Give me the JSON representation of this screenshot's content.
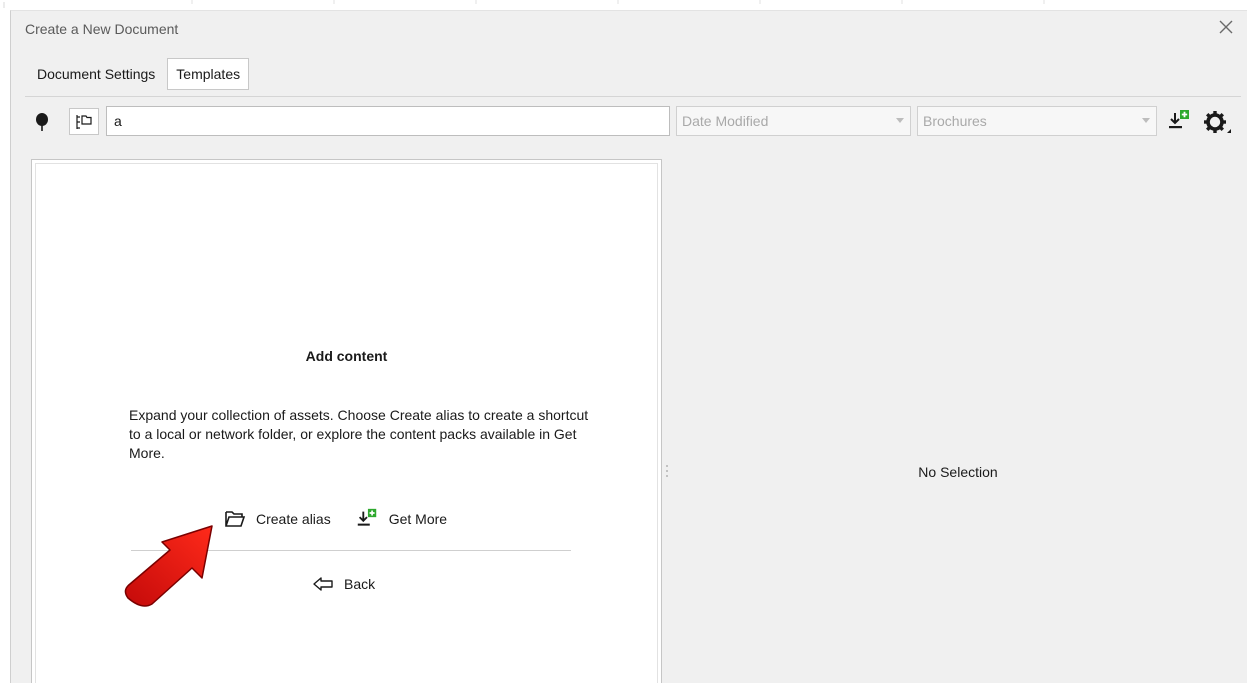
{
  "window": {
    "title": "Create a New Document",
    "close_label": "×"
  },
  "tabs": [
    {
      "label": "Document Settings",
      "active": false
    },
    {
      "label": "Templates",
      "active": true
    }
  ],
  "toolbar": {
    "pin_icon": "pin-icon",
    "tree_icon": "folder-tree-icon",
    "search_value": "a",
    "sort_select": {
      "value": "Date Modified",
      "enabled": false
    },
    "category_select": {
      "value": "Brochures",
      "enabled": false
    },
    "get_more_icon": "download-add-icon",
    "settings_icon": "gear-icon"
  },
  "left_panel": {
    "title": "Add content",
    "description": "Expand your collection of assets. Choose Create alias to create a shortcut to a local or network folder, or explore the content packs available in Get More.",
    "create_alias_label": "Create alias",
    "get_more_label": "Get More",
    "back_label": "Back"
  },
  "right_panel": {
    "placeholder": "No Selection"
  },
  "colors": {
    "dialog_bg": "#f0f0f0",
    "panel_bg": "#ffffff",
    "accent_green": "#2ea82e",
    "annotation_red": "#e01414"
  }
}
